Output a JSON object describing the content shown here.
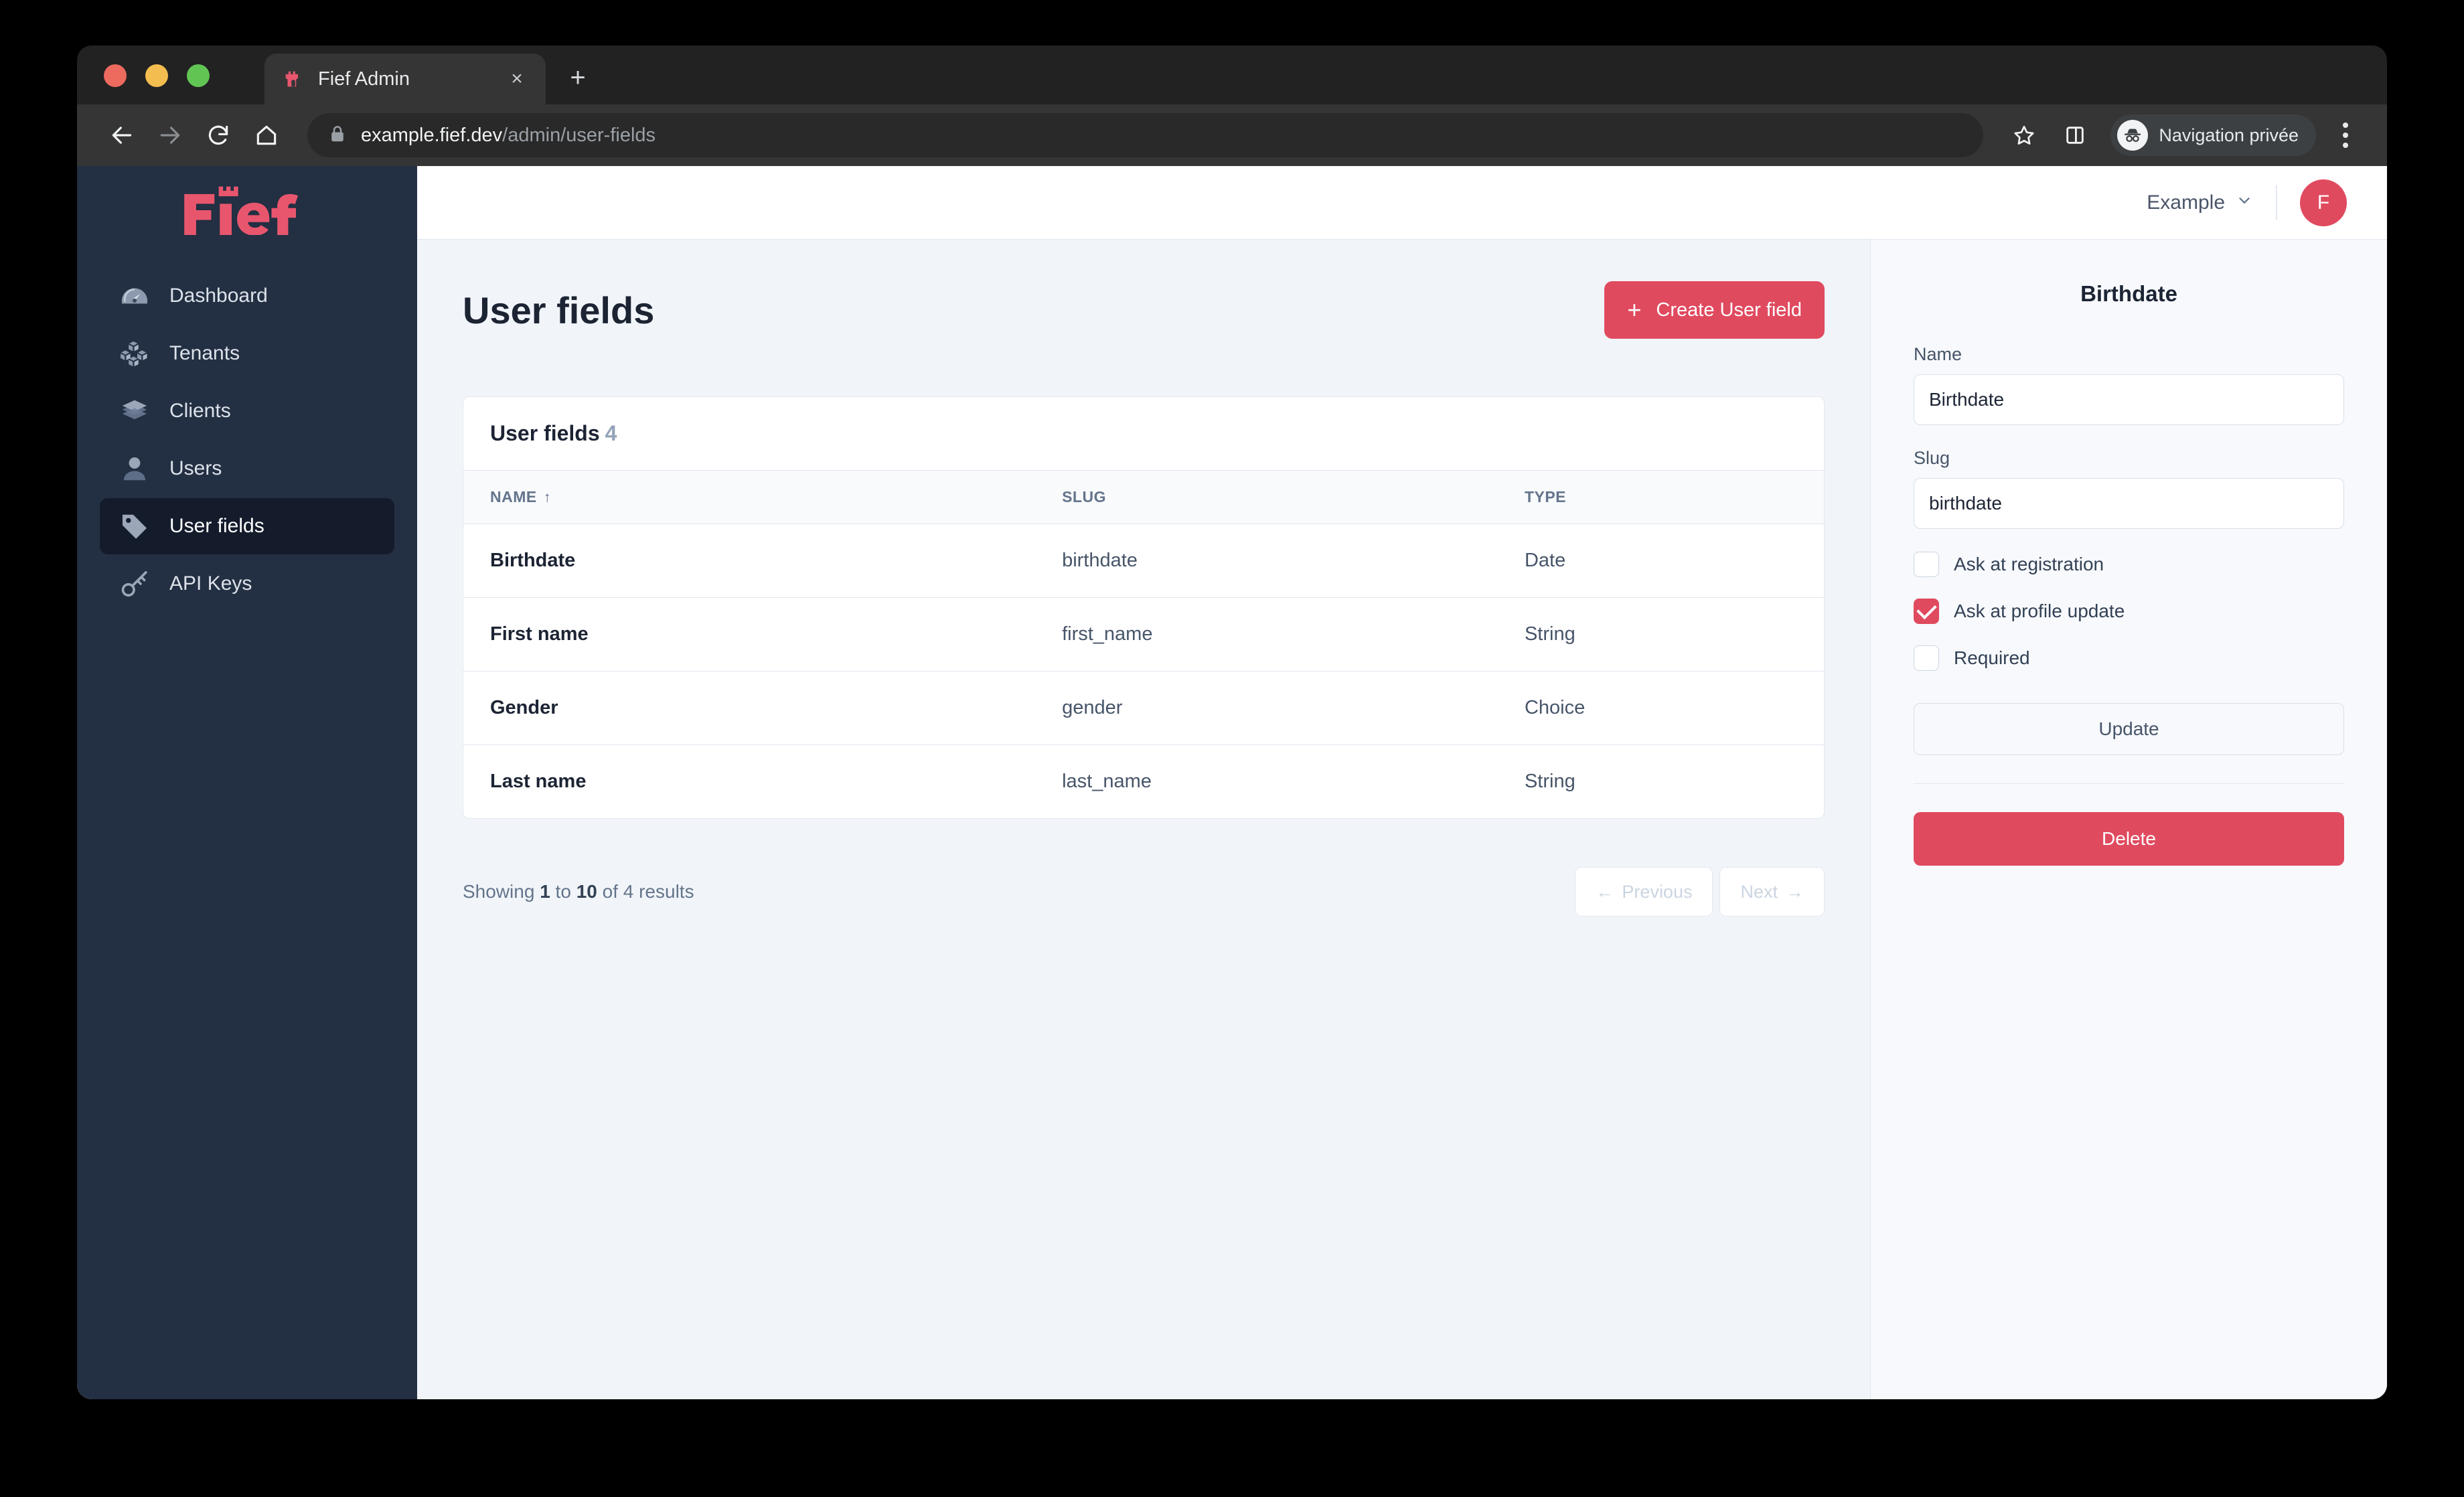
{
  "browser": {
    "tab": {
      "title": "Fief Admin",
      "favicon": "fief-castle-icon",
      "close_label": "×"
    },
    "new_tab_label": "+",
    "nav": {
      "back": "back-arrow-icon",
      "forward": "forward-arrow-icon",
      "reload": "reload-icon",
      "home": "home-icon"
    },
    "omnibox": {
      "lock": "lock-icon",
      "url_domain": "example.fief.dev",
      "url_path": "/admin/user-fields"
    },
    "actions": {
      "bookmark": "star-icon",
      "side_panel": "side-panel-icon",
      "incognito_label": "Navigation privée",
      "menu": "kebab-menu-icon"
    },
    "window_chevron": "chevron-down-icon"
  },
  "sidebar": {
    "logo_text": "Fief",
    "items": [
      {
        "label": "Dashboard",
        "icon": "gauge-icon",
        "active": false
      },
      {
        "label": "Tenants",
        "icon": "cubes-icon",
        "active": false
      },
      {
        "label": "Clients",
        "icon": "layers-icon",
        "active": false
      },
      {
        "label": "Users",
        "icon": "person-icon",
        "active": false
      },
      {
        "label": "User fields",
        "icon": "tag-icon",
        "active": true
      },
      {
        "label": "API Keys",
        "icon": "key-icon",
        "active": false
      }
    ]
  },
  "header": {
    "tenant": "Example",
    "tenant_chevron": "chevron-down-icon",
    "avatar_initial": "F"
  },
  "main": {
    "page_title": "User fields",
    "create_button": "Create User field",
    "create_button_icon": "plus-icon",
    "card_title": "User fields",
    "card_count": "4",
    "columns": [
      {
        "label": "NAME",
        "sort": "↑"
      },
      {
        "label": "SLUG",
        "sort": ""
      },
      {
        "label": "TYPE",
        "sort": ""
      }
    ],
    "rows": [
      {
        "name": "Birthdate",
        "slug": "birthdate",
        "type": "Date"
      },
      {
        "name": "First name",
        "slug": "first_name",
        "type": "String"
      },
      {
        "name": "Gender",
        "slug": "gender",
        "type": "Choice"
      },
      {
        "name": "Last name",
        "slug": "last_name",
        "type": "String"
      }
    ],
    "pagination": {
      "showing_prefix": "Showing ",
      "from": "1",
      "mid": " to ",
      "to": "10",
      "suffix": " of 4 results",
      "previous": "Previous",
      "next": "Next",
      "previous_arrow": "←",
      "next_arrow": "→"
    }
  },
  "side_panel": {
    "title": "Birthdate",
    "name_label": "Name",
    "name_value": "Birthdate",
    "slug_label": "Slug",
    "slug_value": "birthdate",
    "checkboxes": [
      {
        "label": "Ask at registration",
        "checked": false
      },
      {
        "label": "Ask at profile update",
        "checked": true
      },
      {
        "label": "Required",
        "checked": false
      }
    ],
    "update_button": "Update",
    "delete_button": "Delete"
  },
  "colors": {
    "accent": "#E04A5F",
    "sidebar_bg": "#232F42",
    "sidebar_active_bg": "#141C2C",
    "page_bg": "#F1F5F9",
    "text_dark": "#1C2434"
  }
}
